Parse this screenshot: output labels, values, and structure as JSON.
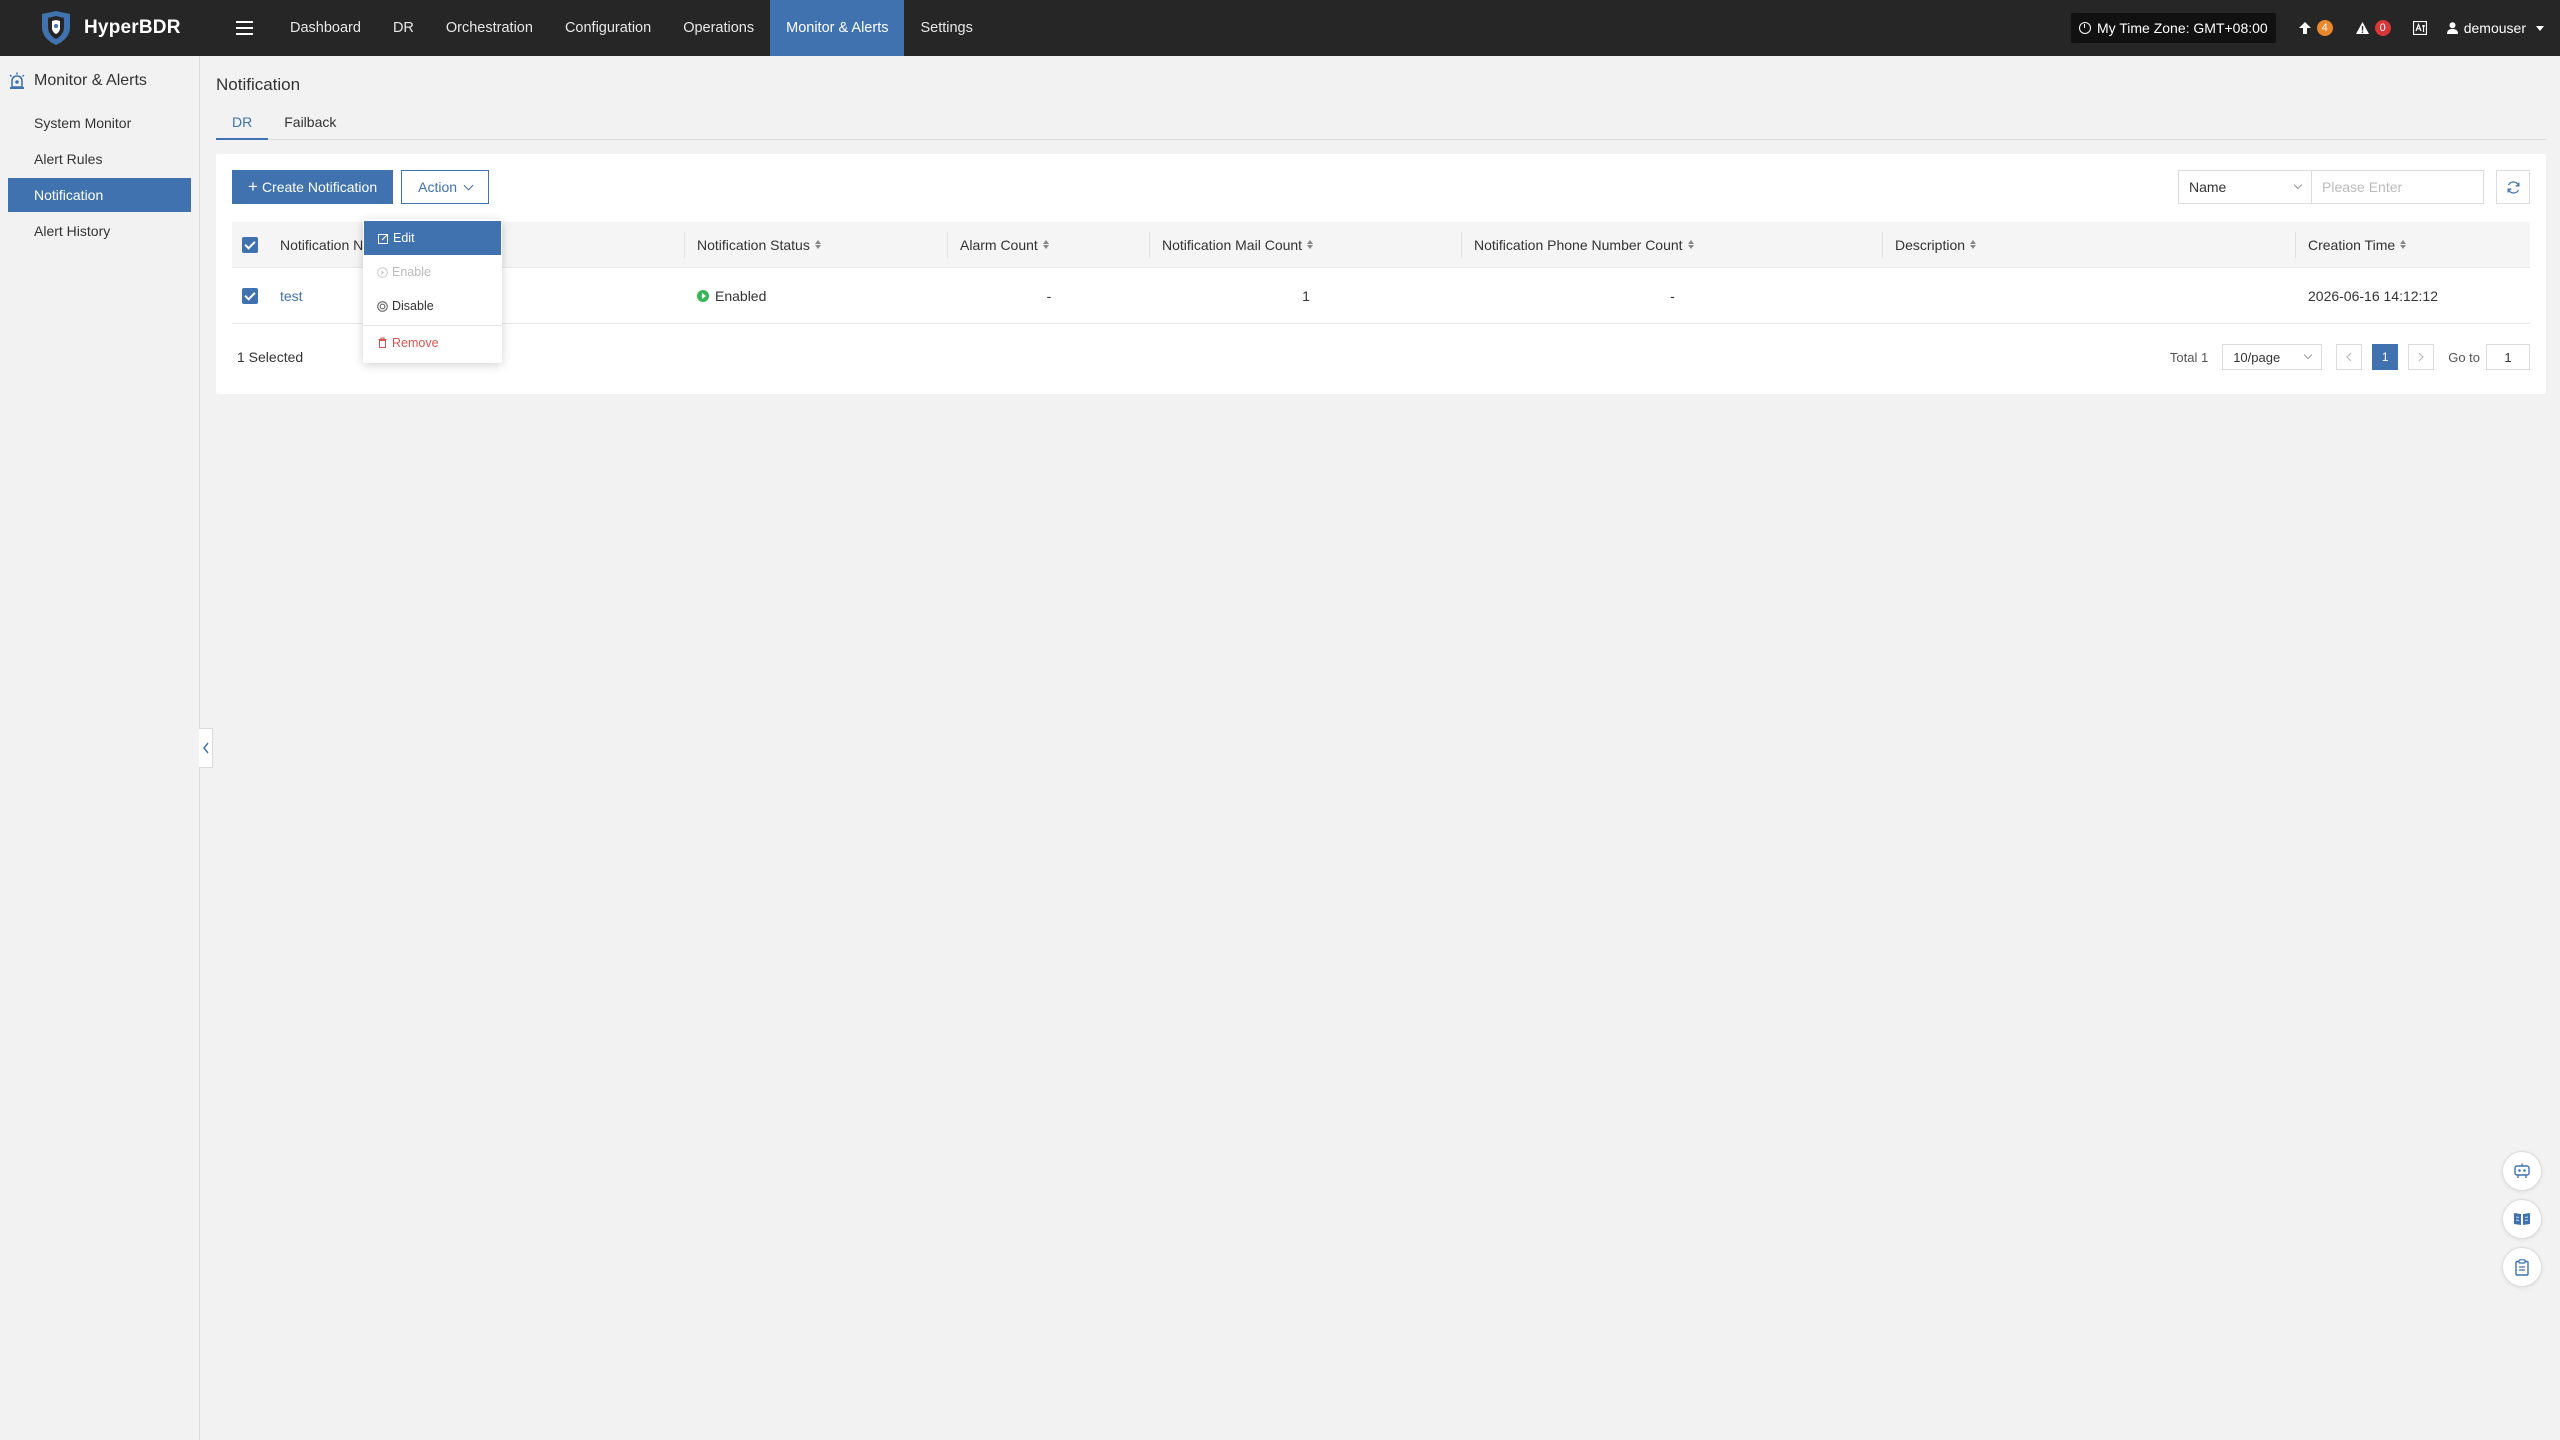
{
  "app": {
    "name": "HyperBDR"
  },
  "nav": {
    "items": [
      {
        "label": "Dashboard"
      },
      {
        "label": "DR"
      },
      {
        "label": "Orchestration"
      },
      {
        "label": "Configuration"
      },
      {
        "label": "Operations"
      },
      {
        "label": "Monitor & Alerts"
      },
      {
        "label": "Settings"
      }
    ],
    "active": "Monitor & Alerts"
  },
  "topright": {
    "timezone": "My Time Zone: GMT+08:00",
    "upgrade_count": "4",
    "alert_count": "0",
    "username": "demouser"
  },
  "sidebar": {
    "title": "Monitor & Alerts",
    "items": [
      {
        "label": "System Monitor"
      },
      {
        "label": "Alert Rules"
      },
      {
        "label": "Notification"
      },
      {
        "label": "Alert History"
      }
    ],
    "active": "Notification"
  },
  "page": {
    "title": "Notification",
    "tabs": [
      {
        "label": "DR"
      },
      {
        "label": "Failback"
      }
    ],
    "active_tab": "DR"
  },
  "toolbar": {
    "create_label": "Create Notification",
    "action_label": "Action"
  },
  "search": {
    "field": "Name",
    "placeholder": "Please Enter"
  },
  "table": {
    "columns": [
      "Notification Name",
      "Notification Status",
      "Alarm Count",
      "Notification Mail Count",
      "Notification Phone Number Count",
      "Description",
      "Creation Time"
    ],
    "rows": [
      {
        "name": "test",
        "status": "Enabled",
        "alarm_count": "-",
        "mail_count": "1",
        "phone_count": "-",
        "description": "",
        "creation_time": "2026-06-16 14:12:12"
      }
    ]
  },
  "footer": {
    "selected": "1 Selected",
    "total": "Total 1",
    "per_page": "10/page",
    "current_page": "1",
    "goto_label": "Go to",
    "goto_value": "1"
  },
  "action_menu": {
    "items": [
      {
        "label": "Edit",
        "state": "hover"
      },
      {
        "label": "Enable",
        "state": "disabled"
      },
      {
        "label": "Disable",
        "state": "normal"
      },
      {
        "label": "Remove",
        "state": "danger"
      }
    ]
  },
  "colors": {
    "topbar_bg": "#262626",
    "accent": "#3f72ae",
    "enabled_green": "#3bb55a",
    "danger": "#d9534f",
    "badge_orange": "#e9882b",
    "badge_red": "#d73737"
  }
}
